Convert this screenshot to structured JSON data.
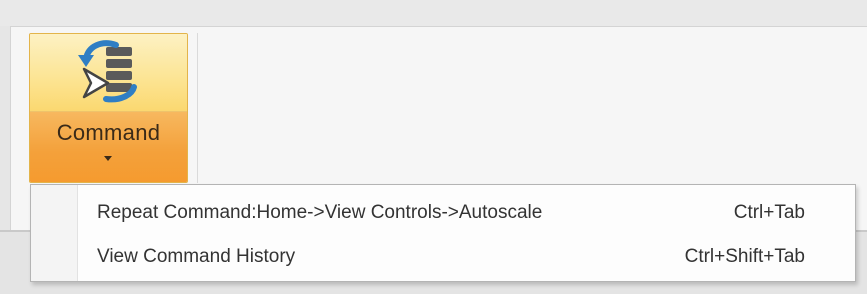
{
  "ribbon": {
    "command_button": {
      "label": "Command",
      "icon": "repeat-command-icon"
    }
  },
  "menu": {
    "items": [
      {
        "label": "Repeat Command:Home->View Controls->Autoscale",
        "shortcut": "Ctrl+Tab"
      },
      {
        "label": "View Command History",
        "shortcut": "Ctrl+Shift+Tab"
      }
    ]
  },
  "colors": {
    "button_top": "#fce596",
    "button_bottom": "#f4a13b",
    "icon_blue": "#2f7ec4",
    "icon_gray": "#5a5a5a"
  }
}
